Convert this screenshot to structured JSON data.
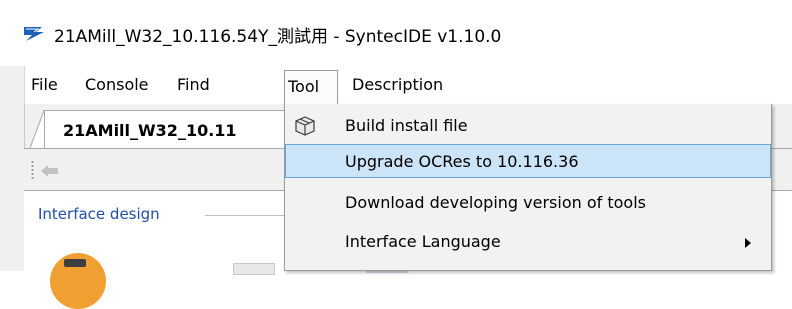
{
  "window": {
    "title": "21AMill_W32_10.116.54Y_測試用 - SyntecIDE v1.10.0"
  },
  "menubar": {
    "items": [
      {
        "label": "File"
      },
      {
        "label": "Console"
      },
      {
        "label": "Find"
      },
      {
        "label": "Tool"
      },
      {
        "label": "Description"
      }
    ],
    "open_menu": "Tool"
  },
  "tabs": [
    {
      "label": "21AMill_W32_10.11",
      "active": true
    }
  ],
  "panel": {
    "group_label": "Interface design"
  },
  "tool_menu": {
    "items": [
      {
        "label": "Build install file",
        "icon": "package-box-icon"
      },
      {
        "label": "Upgrade OCRes to 10.116.36",
        "highlighted": true
      },
      {
        "label": "Download developing version of tools"
      },
      {
        "label": "Interface Language",
        "has_submenu": true
      }
    ]
  },
  "colors": {
    "highlight_bg": "#cce4f7",
    "highlight_border": "#6aa7d8",
    "group_label": "#1f4fa8",
    "accent_orange": "#f0a032"
  }
}
